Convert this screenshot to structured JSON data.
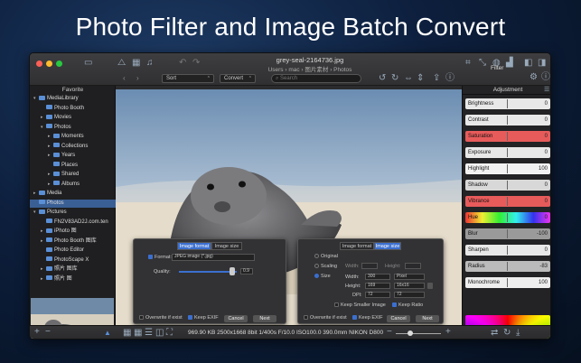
{
  "headline": "Photo Filter and Image Batch Convert",
  "window": {
    "file_title": "grey-seal-2164736.jpg",
    "path": "Users › mac › 图片素材 › Photos",
    "sort_label": "Sort",
    "convert_label": "Convert",
    "search_placeholder": "Search",
    "filter_label": "Filter"
  },
  "sidebar": {
    "header": "Favorite",
    "items": [
      {
        "label": "MediaLibrary",
        "indent": 0,
        "caret": "▾"
      },
      {
        "label": "Photo Booth",
        "indent": 1,
        "caret": ""
      },
      {
        "label": "Movies",
        "indent": 1,
        "caret": "▸"
      },
      {
        "label": "Photos",
        "indent": 1,
        "caret": "▾"
      },
      {
        "label": "Moments",
        "indent": 2,
        "caret": "▸"
      },
      {
        "label": "Collections",
        "indent": 2,
        "caret": "▸"
      },
      {
        "label": "Years",
        "indent": 2,
        "caret": "▸"
      },
      {
        "label": "Places",
        "indent": 2,
        "caret": ""
      },
      {
        "label": "Shared",
        "indent": 2,
        "caret": "▸"
      },
      {
        "label": "Albums",
        "indent": 2,
        "caret": "▸"
      },
      {
        "label": "Media",
        "indent": 0,
        "caret": "▸"
      },
      {
        "label": "Photos",
        "indent": 0,
        "caret": "",
        "selected": true
      },
      {
        "label": "Pictures",
        "indent": 0,
        "caret": "▾"
      },
      {
        "label": "FN2V83AD2J.com.ten",
        "indent": 1,
        "caret": ""
      },
      {
        "label": "iPhoto 图",
        "indent": 1,
        "caret": "▸"
      },
      {
        "label": "Photo Booth 图库",
        "indent": 1,
        "caret": "▸"
      },
      {
        "label": "Photo Editor",
        "indent": 1,
        "caret": ""
      },
      {
        "label": "PhotoScape X",
        "indent": 1,
        "caret": ""
      },
      {
        "label": "照片 图库",
        "indent": 1,
        "caret": "▸"
      },
      {
        "label": "照片 图",
        "indent": 1,
        "caret": "▸"
      }
    ]
  },
  "adjustment": {
    "header": "Adjustment",
    "sliders": [
      {
        "label": "Brightness",
        "value": "0",
        "color": "#e8e8e8"
      },
      {
        "label": "Contrast",
        "value": "0",
        "color": "#e8e8e8"
      },
      {
        "label": "Saturation",
        "value": "0",
        "color": "#e85b5b"
      },
      {
        "label": "Exposure",
        "value": "0",
        "color": "#e8e8e8"
      },
      {
        "label": "Highlight",
        "value": "100",
        "color": "#f2f2f2"
      },
      {
        "label": "Shadow",
        "value": "0",
        "color": "#d8d8d8"
      },
      {
        "label": "Vibrance",
        "value": "0",
        "color": "#e85b5b"
      },
      {
        "label": "Hue",
        "value": "0",
        "color": "linear-gradient(90deg,#e33,#ee3,#3e3,#3ee,#33e,#e3e)"
      },
      {
        "label": "Blur",
        "value": "-100",
        "color": "#9a9a9a"
      },
      {
        "label": "Sharpen",
        "value": "0",
        "color": "#e8e8e8"
      },
      {
        "label": "Radius",
        "value": "-83",
        "color": "#bbbbbb"
      },
      {
        "label": "Monochrome",
        "value": "100",
        "color": "#eeeeee"
      }
    ]
  },
  "panel1": {
    "tab1": "Image format",
    "tab2": "Image size",
    "format_label": "Format:",
    "format_value": "JPEG image (*.jpg)",
    "quality_label": "Quality:",
    "quality_value": "0.9",
    "overwrite": "Overwrite if exist",
    "keep_exif": "Keep EXIF",
    "cancel": "Cancel",
    "next": "Next"
  },
  "panel2": {
    "tab1": "Image format",
    "tab2": "Image size",
    "original": "Original",
    "scaling": "Scaling",
    "size": "Size",
    "width_label": "Width:",
    "height_label": "Height:",
    "width_value": "300",
    "height_value": "169",
    "unit": "Pixel",
    "preset": "16x16",
    "dpi_label": "DPI:",
    "dpi_value": "72",
    "dpi_select": "72",
    "keep_smaller": "Keep Smaller Image",
    "keep_ratio": "Keep Ratio",
    "overwrite": "Overwrite if exist",
    "keep_exif": "Keep EXIF",
    "cancel": "Cancel",
    "next": "Next"
  },
  "status": {
    "info": "969.90 KB  2500x1668  8bit  1/400s  F/10.0  ISO100.0  390.0mm  NIKON D800"
  }
}
